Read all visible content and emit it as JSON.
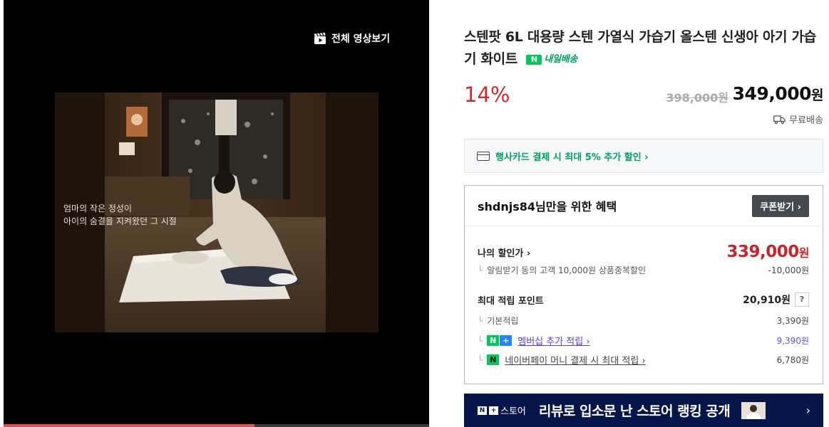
{
  "video": {
    "full_video_label": "전체 영상보기",
    "caption_line1": "엄마의 작은 정성이",
    "caption_line2": "아이의 숨결을 지켜왔던 그 시절",
    "progress_fraction": 0.59
  },
  "product": {
    "title": "스텐팟 6L 대용량 스텐 가열식 가습기 올스텐 신생아 아기 가습기 화이트",
    "ship_badge_icon": "N",
    "ship_badge_label": "내일배송",
    "discount": "14%",
    "original_price": "398,000원",
    "price_number": "349,000",
    "price_unit": "원",
    "free_shipping": "무료배송"
  },
  "card_event": {
    "label": "행사카드 결제 시 최대 5% 추가 할인 ›"
  },
  "benefit": {
    "title": "shdnjs84님만을 위한 혜택",
    "coupon_button": "쿠폰받기 ›",
    "my_price_label": "나의 할인가 ›",
    "my_price_number": "339,000",
    "my_price_unit": "원",
    "alert_label": "알림받기 동의 고객 10,000원 상품중복할인",
    "alert_value": "-10,000원",
    "points_label": "최대 적립 포인트",
    "points_total": "20,910원",
    "help": "?",
    "basic_label": "기본적립",
    "basic_value": "3,390원",
    "membership_label": "멤버십 추가 적립 ›",
    "membership_value": "9,390원",
    "npay_label": "네이버페이 머니 결제 시 최대 적립 ›",
    "npay_value": "6,780원",
    "branch": "└"
  },
  "banner": {
    "logo_text": "스토어",
    "text": "리뷰로 입소문 난 스토어 랭킹 공개",
    "arrow": "›"
  },
  "colors": {
    "discount": "#d0282f",
    "green": "#03c75a",
    "banner_bg": "#06154a",
    "purple": "#6a4ad6"
  }
}
